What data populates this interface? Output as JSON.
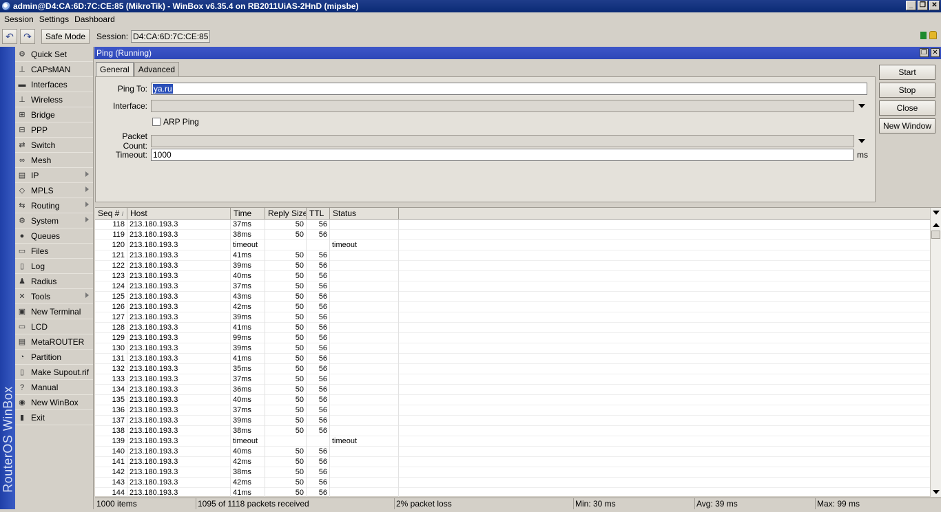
{
  "window": {
    "title": "admin@D4:CA:6D:7C:CE:85 (MikroTik) - WinBox v6.35.4 on RB2011UiAS-2HnD (mipsbe)",
    "controls": [
      "_",
      "❐",
      "✕"
    ]
  },
  "menu": [
    "Session",
    "Settings",
    "Dashboard"
  ],
  "toolbar": {
    "undo_icon": "↶",
    "redo_icon": "↷",
    "safe_mode": "Safe Mode",
    "session_label": "Session:",
    "session_value": "D4:CA:6D:7C:CE:85"
  },
  "brand": "RouterOS WinBox",
  "sidebar": [
    {
      "label": "Quick Set",
      "icon": "⚙",
      "sub": false
    },
    {
      "label": "CAPsMAN",
      "icon": "⊥",
      "sub": false
    },
    {
      "label": "Interfaces",
      "icon": "▬",
      "sub": false
    },
    {
      "label": "Wireless",
      "icon": "⊥",
      "sub": false
    },
    {
      "label": "Bridge",
      "icon": "⊞",
      "sub": false
    },
    {
      "label": "PPP",
      "icon": "⊟",
      "sub": false
    },
    {
      "label": "Switch",
      "icon": "⇄",
      "sub": false
    },
    {
      "label": "Mesh",
      "icon": "∞",
      "sub": false
    },
    {
      "label": "IP",
      "icon": "▤",
      "sub": true
    },
    {
      "label": "MPLS",
      "icon": "◇",
      "sub": true
    },
    {
      "label": "Routing",
      "icon": "⇆",
      "sub": true
    },
    {
      "label": "System",
      "icon": "⚙",
      "sub": true
    },
    {
      "label": "Queues",
      "icon": "●",
      "sub": false
    },
    {
      "label": "Files",
      "icon": "▭",
      "sub": false
    },
    {
      "label": "Log",
      "icon": "▯",
      "sub": false
    },
    {
      "label": "Radius",
      "icon": "♟",
      "sub": false
    },
    {
      "label": "Tools",
      "icon": "✕",
      "sub": true
    },
    {
      "label": "New Terminal",
      "icon": "▣",
      "sub": false
    },
    {
      "label": "LCD",
      "icon": "▭",
      "sub": false
    },
    {
      "label": "MetaROUTER",
      "icon": "▤",
      "sub": false
    },
    {
      "label": "Partition",
      "icon": "◔",
      "sub": false
    },
    {
      "label": "Make Supout.rif",
      "icon": "▯",
      "sub": false
    },
    {
      "label": "Manual",
      "icon": "?",
      "sub": false
    },
    {
      "label": "New WinBox",
      "icon": "◉",
      "sub": false
    },
    {
      "label": "Exit",
      "icon": "▮",
      "sub": false
    }
  ],
  "ping": {
    "title": "Ping (Running)",
    "tabs": [
      "General",
      "Advanced"
    ],
    "labels": {
      "ping_to": "Ping To:",
      "interface": "Interface:",
      "arp_ping": "ARP Ping",
      "packet_count": "Packet Count:",
      "timeout": "Timeout:",
      "ms": "ms"
    },
    "values": {
      "ping_to": "ya.ru",
      "interface": "",
      "packet_count": "",
      "timeout": "1000"
    },
    "arp_ping_checked": false,
    "buttons": [
      "Start",
      "Stop",
      "Close",
      "New Window"
    ]
  },
  "table": {
    "columns": [
      "Seq # ",
      "Host",
      "Time",
      "Reply Size",
      "TTL",
      "Status"
    ],
    "sort_indicator": "/",
    "rows": [
      [
        "118",
        "213.180.193.3",
        "37ms",
        "50",
        "56",
        ""
      ],
      [
        "119",
        "213.180.193.3",
        "38ms",
        "50",
        "56",
        ""
      ],
      [
        "120",
        "213.180.193.3",
        "timeout",
        "",
        "",
        "timeout"
      ],
      [
        "121",
        "213.180.193.3",
        "41ms",
        "50",
        "56",
        ""
      ],
      [
        "122",
        "213.180.193.3",
        "39ms",
        "50",
        "56",
        ""
      ],
      [
        "123",
        "213.180.193.3",
        "40ms",
        "50",
        "56",
        ""
      ],
      [
        "124",
        "213.180.193.3",
        "37ms",
        "50",
        "56",
        ""
      ],
      [
        "125",
        "213.180.193.3",
        "43ms",
        "50",
        "56",
        ""
      ],
      [
        "126",
        "213.180.193.3",
        "42ms",
        "50",
        "56",
        ""
      ],
      [
        "127",
        "213.180.193.3",
        "39ms",
        "50",
        "56",
        ""
      ],
      [
        "128",
        "213.180.193.3",
        "41ms",
        "50",
        "56",
        ""
      ],
      [
        "129",
        "213.180.193.3",
        "99ms",
        "50",
        "56",
        ""
      ],
      [
        "130",
        "213.180.193.3",
        "39ms",
        "50",
        "56",
        ""
      ],
      [
        "131",
        "213.180.193.3",
        "41ms",
        "50",
        "56",
        ""
      ],
      [
        "132",
        "213.180.193.3",
        "35ms",
        "50",
        "56",
        ""
      ],
      [
        "133",
        "213.180.193.3",
        "37ms",
        "50",
        "56",
        ""
      ],
      [
        "134",
        "213.180.193.3",
        "36ms",
        "50",
        "56",
        ""
      ],
      [
        "135",
        "213.180.193.3",
        "40ms",
        "50",
        "56",
        ""
      ],
      [
        "136",
        "213.180.193.3",
        "37ms",
        "50",
        "56",
        ""
      ],
      [
        "137",
        "213.180.193.3",
        "39ms",
        "50",
        "56",
        ""
      ],
      [
        "138",
        "213.180.193.3",
        "38ms",
        "50",
        "56",
        ""
      ],
      [
        "139",
        "213.180.193.3",
        "timeout",
        "",
        "",
        "timeout"
      ],
      [
        "140",
        "213.180.193.3",
        "40ms",
        "50",
        "56",
        ""
      ],
      [
        "141",
        "213.180.193.3",
        "42ms",
        "50",
        "56",
        ""
      ],
      [
        "142",
        "213.180.193.3",
        "38ms",
        "50",
        "56",
        ""
      ],
      [
        "143",
        "213.180.193.3",
        "42ms",
        "50",
        "56",
        ""
      ],
      [
        "144",
        "213.180.193.3",
        "41ms",
        "50",
        "56",
        ""
      ]
    ]
  },
  "status": {
    "items": "1000 items",
    "received": "1095 of 1118 packets received",
    "loss": "2% packet loss",
    "min": "Min: 30 ms",
    "avg": "Avg: 39 ms",
    "max": "Max: 99 ms"
  },
  "colors": {
    "title_bar": "#0a2a75",
    "window_title": "#3d56c8",
    "brand_bar": "#2a4bb8"
  }
}
